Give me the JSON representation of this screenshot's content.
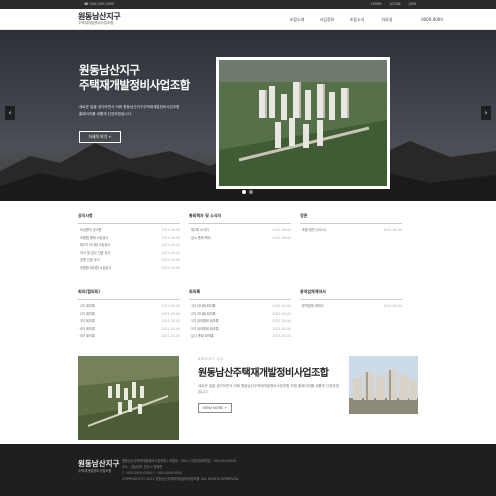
{
  "topbar": {
    "phone": "☎ 000-000-0000",
    "links": [
      "HOME",
      "LOGIN",
      "JOIN"
    ]
  },
  "header": {
    "logo_line1": "원동남산지구",
    "logo_line2": "주택재개발정비사업조합",
    "nav": [
      "조합소개",
      "사업정보",
      "조합소식",
      "자료실",
      "0000-0000"
    ]
  },
  "hero": {
    "title_line1": "원동남산지구",
    "title_line2": "주택재개발정비사업조합",
    "desc_line1": "새로운 일을 생각하면서 저희 원동남산지구주택재개발정비사업조합",
    "desc_line2": "홈페이지를 새롭게 단장하였습니다.",
    "button": "자세히 보기 +",
    "prev": "‹",
    "next": "›"
  },
  "boards": [
    {
      "title": "공지사항",
      "items": [
        {
          "t": "· 보상협의 공고문",
          "d": "2021-00-00"
        },
        {
          "t": "· 조합원 총회 소집공고",
          "d": "2021-00-00"
        },
        {
          "t": "· 제2차 이사회 소집공고",
          "d": "2021-00-00"
        },
        {
          "t": "· 이사 및 감사 선출 공고",
          "d": "2021-00-00"
        },
        {
          "t": "· 임원 선출 공고",
          "d": "2021-00-00"
        },
        {
          "t": "· 조합원 대의원 소집공고",
          "d": "2021-00-00"
        }
      ]
    },
    {
      "title": "총회책자 및 소식지",
      "items": [
        {
          "t": "· 제1회 소식지",
          "d": "2021-00-00"
        },
        {
          "t": "· 임시 총회 책자",
          "d": "2021-00-00"
        }
      ]
    },
    {
      "title": "정관",
      "items": [
        {
          "t": "· 조합 정관 (2021)",
          "d": "2021-00-00"
        }
      ]
    },
    {
      "title": "회의(협의회)",
      "items": [
        {
          "t": "· 1차 회의록",
          "d": "2021-00-00"
        },
        {
          "t": "· 2차 회의록",
          "d": "2021-00-00"
        },
        {
          "t": "· 3차 회의록",
          "d": "2021-00-00"
        },
        {
          "t": "· 4차 회의록",
          "d": "2021-00-00"
        },
        {
          "t": "· 5차 회의록",
          "d": "2021-00-00"
        }
      ]
    },
    {
      "title": "회의록",
      "items": [
        {
          "t": "· 1차 이사회 회의록",
          "d": "2021-00-00"
        },
        {
          "t": "· 2차 이사회 회의록",
          "d": "2021-00-00"
        },
        {
          "t": "· 1차 대의원회 회의록",
          "d": "2021-00-00"
        },
        {
          "t": "· 2차 대의원회 회의록",
          "d": "2021-00-00"
        },
        {
          "t": "· 임시 총회 회의록",
          "d": "2021-00-00"
        }
      ]
    },
    {
      "title": "용역업체계약서",
      "items": [
        {
          "t": "· 용역업체 계약서",
          "d": "2021-00-00"
        }
      ]
    }
  ],
  "about": {
    "tag": "ABOUT US",
    "title": "원동남산주택재개발정비사업조합",
    "desc": "새로운 일을 생각하면서 저희 원동남산주택재개발정비사업조합 조합 홈페이지를 새롭게 단장하였습니다.",
    "button": "VIEW MORE +"
  },
  "footer": {
    "logo_line1": "원동남산지구",
    "logo_line2": "주택재개발정비사업조합",
    "info_line1": "원동남산주택재개발정비사업조합 | 조합장 : 000 | 사업자등록번호 : 000-00-00000",
    "info_line2": "주소 : 경상남도 양산시 원동면",
    "info_line3": "T : 000-0000-0000  F : 000-0000-0000",
    "info_line4": "COPYRIGHT(C) 2021 원동남산주택재개발정비사업조합. ALL RIGHTS RESERVED."
  }
}
